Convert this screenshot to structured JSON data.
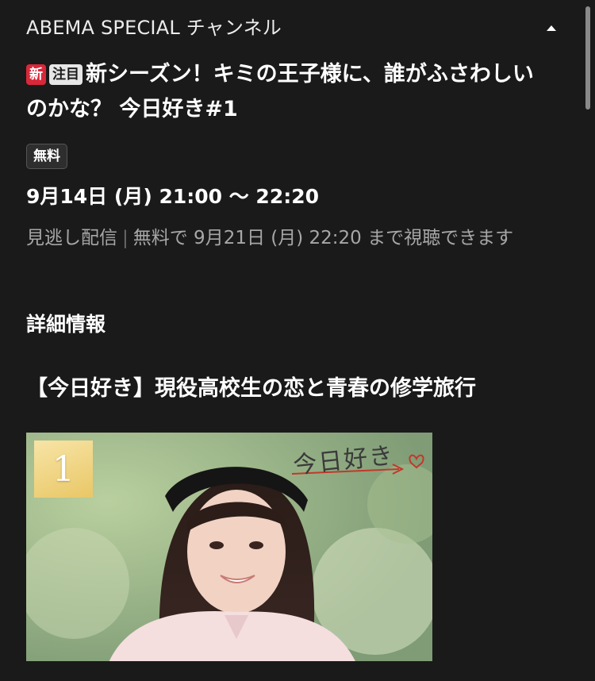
{
  "header": {
    "channel_name": "ABEMA SPECIAL チャンネル",
    "collapse_icon": "caret-up-icon"
  },
  "program": {
    "badges": [
      "新",
      "注目"
    ],
    "title": "新シーズン！キミの王子様に、誰がふさわしいのかな？ 今日好き#1",
    "price_tag": "無料",
    "datetime": "9月14日 (月) 21:00 〜 22:20",
    "catchup_label": "見逃し配信",
    "catchup_detail": "無料で 9月21日 (月) 22:20 まで視聴できます"
  },
  "details": {
    "heading": "詳細情報",
    "episode_title": "【今日好き】現役高校生の恋と青春の修学旅行"
  },
  "thumbnail": {
    "episode_number": "1",
    "logo_text": "今日好き"
  },
  "colors": {
    "background": "#1a1a1a",
    "badge_new": "#d8283a",
    "muted_text": "#a7a7a7"
  }
}
